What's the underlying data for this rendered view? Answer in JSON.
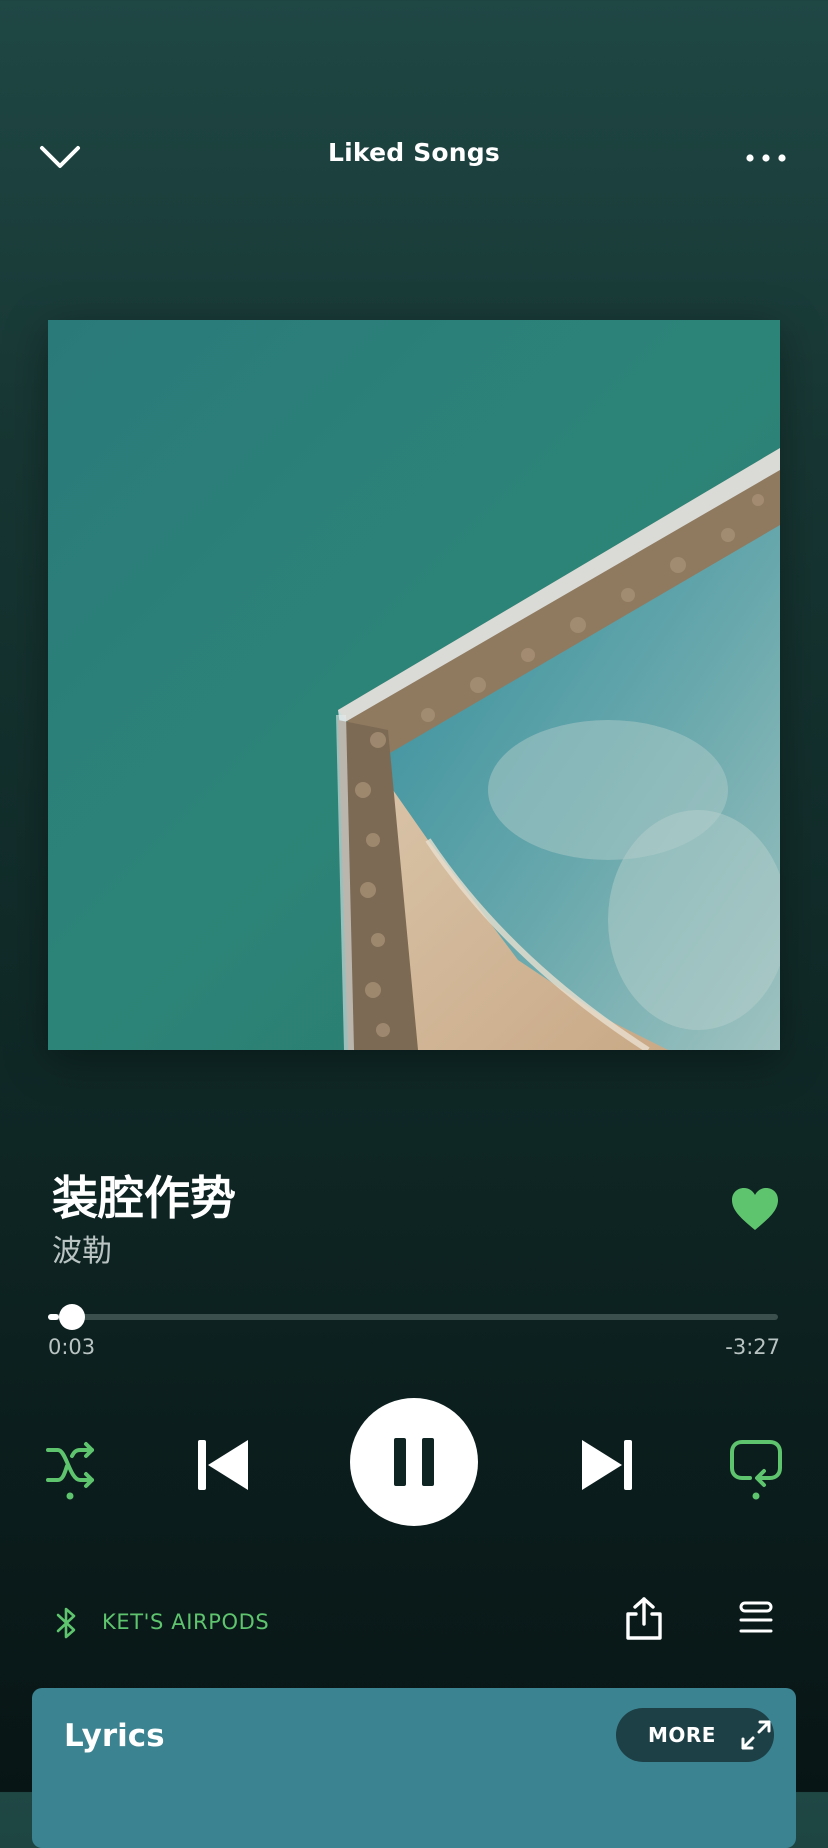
{
  "header": {
    "title": "Liked Songs",
    "collapse_icon": "chevron-down-icon",
    "more_icon": "more-horizontal-icon"
  },
  "song": {
    "title": "装腔作势",
    "artist": "波勒",
    "liked": true
  },
  "playback": {
    "elapsed": "0:03",
    "remaining": "-3:27",
    "progress": 0.015,
    "state": "playing"
  },
  "controls": {
    "shuffle": {
      "icon": "shuffle-icon",
      "active": true
    },
    "previous": {
      "icon": "skip-previous-icon"
    },
    "play_pause": {
      "icon": "pause-icon"
    },
    "next": {
      "icon": "skip-next-icon"
    },
    "repeat": {
      "icon": "repeat-icon",
      "active": true
    }
  },
  "device": {
    "icon": "bluetooth-icon",
    "name": "KET'S AIRPODS"
  },
  "actions": {
    "share_icon": "share-icon",
    "queue_icon": "queue-icon"
  },
  "lyrics": {
    "title": "Lyrics",
    "more_label": "MORE",
    "expand_icon": "expand-icon"
  },
  "colors": {
    "accent": "#5fc46e",
    "lyrics_card": "#3b8391",
    "text_secondary": "#b9c4c2"
  }
}
